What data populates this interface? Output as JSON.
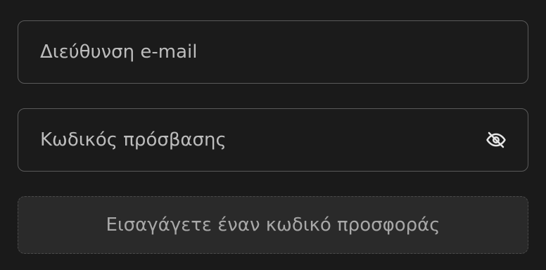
{
  "form": {
    "email": {
      "placeholder": "Διεύθυνση e-mail",
      "value": ""
    },
    "password": {
      "placeholder": "Κωδικός πρόσβασης",
      "value": "",
      "toggle_icon": "eye-off-icon"
    },
    "promo_button_label": "Εισαγάγετε έναν κωδικό προσφοράς"
  },
  "colors": {
    "background": "#1a1a1a",
    "field_border": "#5a5a5a",
    "placeholder_text": "#bdbdbd",
    "promo_background": "#2a2a2a",
    "promo_text": "#a8a8a8"
  }
}
